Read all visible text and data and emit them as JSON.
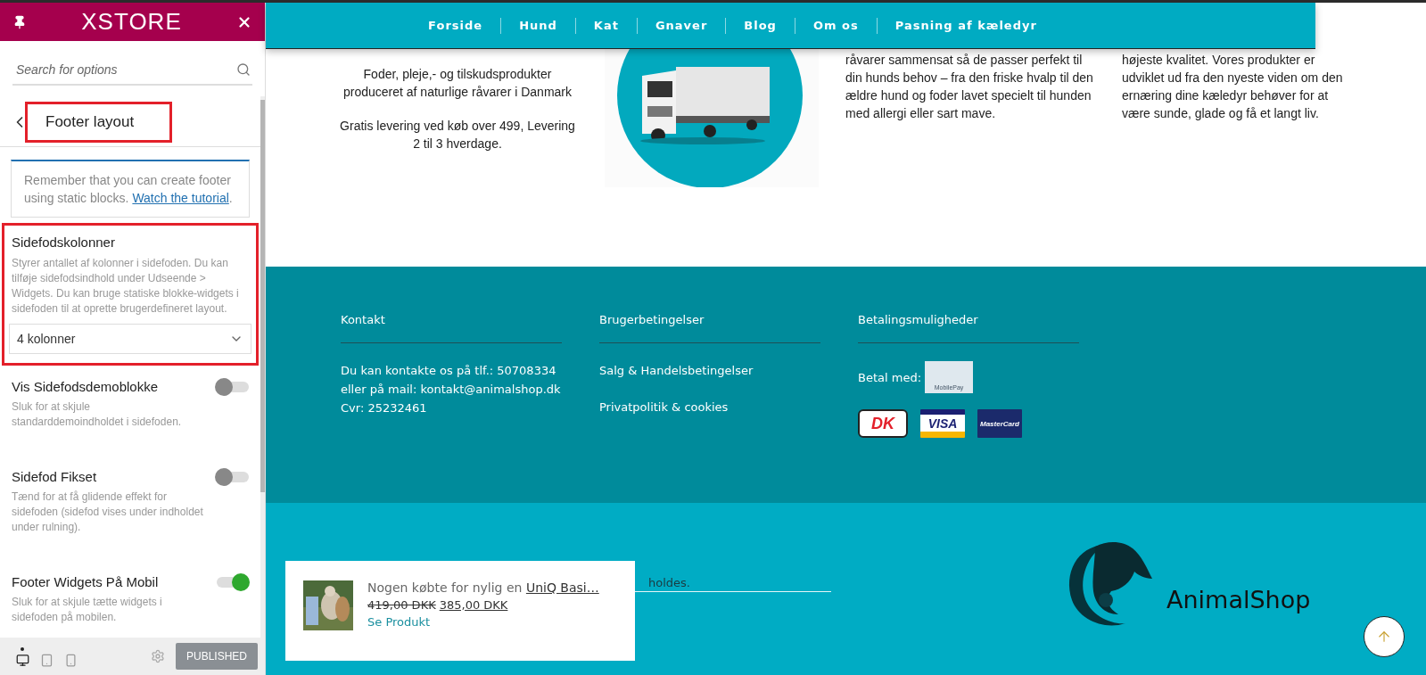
{
  "panel": {
    "logo": "XSTORE",
    "search": {
      "placeholder": "Search for options"
    },
    "section_title": "Footer layout",
    "title_highlighted": true,
    "notice": {
      "text": "Remember that you can create footer using static blocks. ",
      "link": "Watch the tutorial",
      "end": "."
    },
    "settings": [
      {
        "kind": "select",
        "title": "Sidefodskolonner",
        "description": "Styrer antallet af kolonner i sidefoden. Du kan tilføje sidefodsindhold under Udseende > Widgets. Du kan bruge statiske blokke-widgets i sidefoden til at oprette brugerdefineret layout.",
        "value": "4 kolonner",
        "highlighted": true
      },
      {
        "kind": "toggle",
        "title": "Vis Sidefodsdemoblokke",
        "description": "Sluk for at skjule standarddemoindholdet i sidefoden.",
        "on": false,
        "highlighted": false
      },
      {
        "kind": "toggle",
        "title": "Sidefod Fikset",
        "description": "Tænd for at få glidende effekt for sidefoden (sidefod vises under indholdet under rulning).",
        "on": false,
        "highlighted": false
      },
      {
        "kind": "toggle",
        "title": "Footer Widgets På Mobil",
        "description": "Sluk for at skjule tætte widgets i sidefoden på mobilen.",
        "on": true,
        "highlighted": false
      }
    ],
    "devices": [
      {
        "kind": "desktop",
        "selected": true
      },
      {
        "kind": "tablet",
        "selected": false
      },
      {
        "kind": "mobile",
        "selected": false
      }
    ],
    "publish_button": "PUBLISHED"
  },
  "site": {
    "nav": [
      "Forside",
      "Hund",
      "Kat",
      "Gnaver",
      "Blog",
      "Om os",
      "Pasning af kæledyr"
    ],
    "intro": [
      "Foder, pleje,- og tilskudsprodukter produceret af naturlige råvarer i Danmark",
      "Gratis levering ved køb over 499, Levering 2 til 3 hverdage."
    ],
    "column_3": "råvarer sammensat så de passer perfekt til din hunds behov – fra den friske hvalp til den ældre hund og foder lavet specielt til hunden med allergi eller sart mave.",
    "column_4": "højeste kvalitet. Vores produkter er udviklet ud fra den nyeste viden om den ernæring dine kæledyr behøver for at være sunde, glade og få et langt liv.",
    "footer": [
      {
        "kind": "text",
        "heading": "Kontakt",
        "lines": [
          "Du kan kontakte os på tlf.: 50708334  eller på mail: kontakt@animalshop.dk",
          "Cvr: 25232461"
        ]
      },
      {
        "kind": "links",
        "heading": "Brugerbetingelser",
        "lines": [
          "Salg & Handelsbetingelser",
          "Privatpolitik & cookies"
        ]
      },
      {
        "kind": "payment",
        "heading": "Betalingsmuligheder",
        "lines": [
          "Betal med:"
        ],
        "mobilepay": "MobilePay",
        "cards": [
          "DK",
          "VISA",
          "MasterCard"
        ]
      }
    ],
    "bottom_text": "holdes.",
    "brand": "AnimalShop",
    "popup": {
      "text": "Nogen købte for nylig en ",
      "product": "UniQ Basi…",
      "old_price": "419,00 DKK",
      "price": "385,00 DKK",
      "link": "Se Produkt"
    }
  }
}
